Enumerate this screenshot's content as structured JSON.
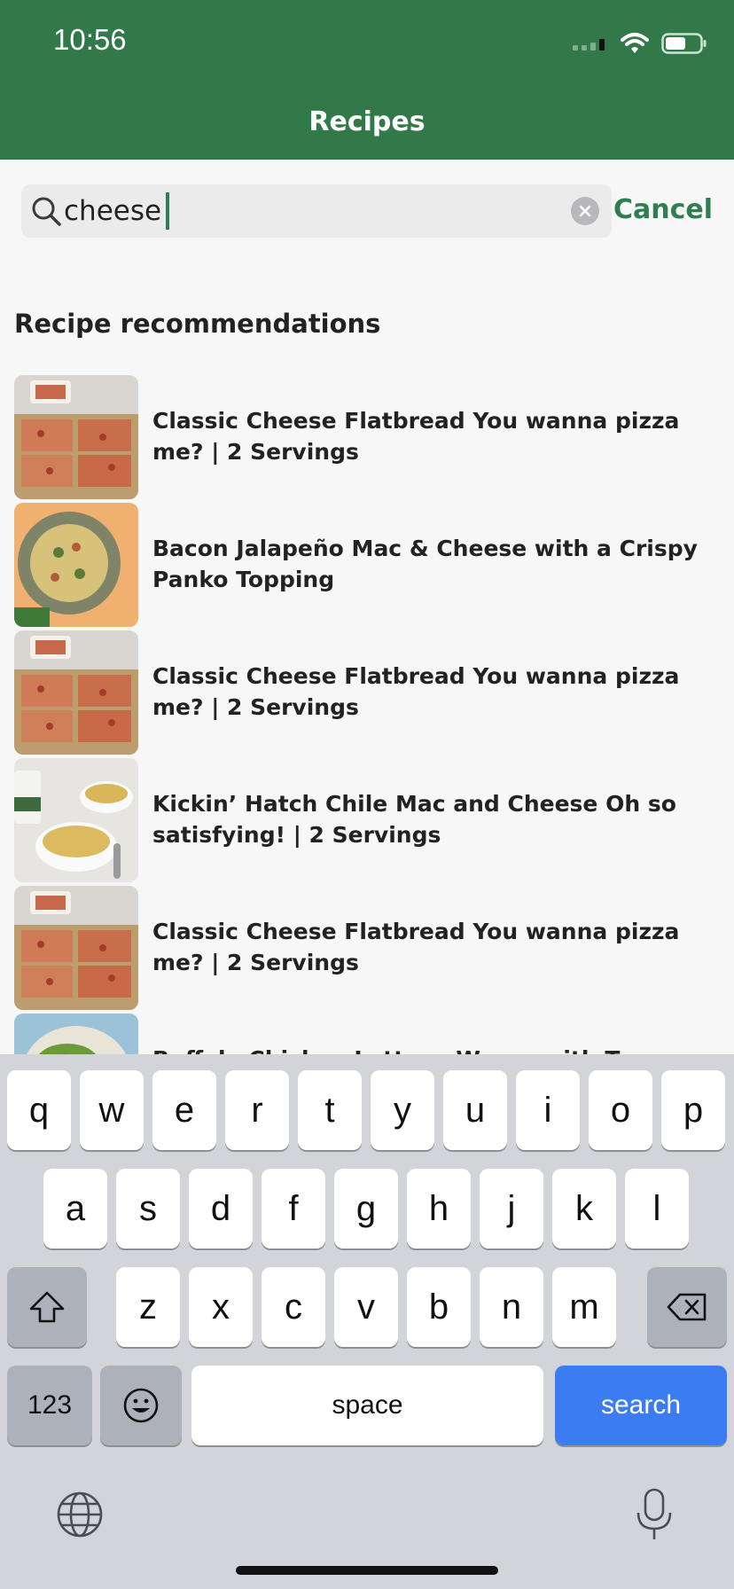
{
  "status_bar": {
    "time": "10:56"
  },
  "header": {
    "title": "Recipes"
  },
  "search": {
    "value": "cheese",
    "cancel_label": "Cancel"
  },
  "section_title": "Recipe recommendations",
  "results": [
    {
      "title": "Classic Cheese Flatbread  You wanna pizza me? | 2 Servings",
      "image": "flatbread"
    },
    {
      "title": "Bacon Jalapeño Mac & Cheese with a Crispy Panko Topping",
      "image": "mac-cheese-plate"
    },
    {
      "title": "Classic Cheese Flatbread  You wanna pizza me? | 2 Servings",
      "image": "flatbread"
    },
    {
      "title": "Kickin’ Hatch Chile Mac and Cheese Oh so satisfying! | 2 Servings",
      "image": "mac-cheese-bowls"
    },
    {
      "title": "Classic Cheese Flatbread  You wanna pizza me? | 2 Servings",
      "image": "flatbread"
    },
    {
      "title": "Buffalo Chicken Lettuce Wraps with Tangy Blue",
      "image": "lettuce-wraps"
    }
  ],
  "keyboard": {
    "row1": [
      "q",
      "w",
      "e",
      "r",
      "t",
      "y",
      "u",
      "i",
      "o",
      "p"
    ],
    "row2": [
      "a",
      "s",
      "d",
      "f",
      "g",
      "h",
      "j",
      "k",
      "l"
    ],
    "row3": [
      "z",
      "x",
      "c",
      "v",
      "b",
      "n",
      "m"
    ],
    "numbers_label": "123",
    "space_label": "space",
    "search_label": "search"
  }
}
